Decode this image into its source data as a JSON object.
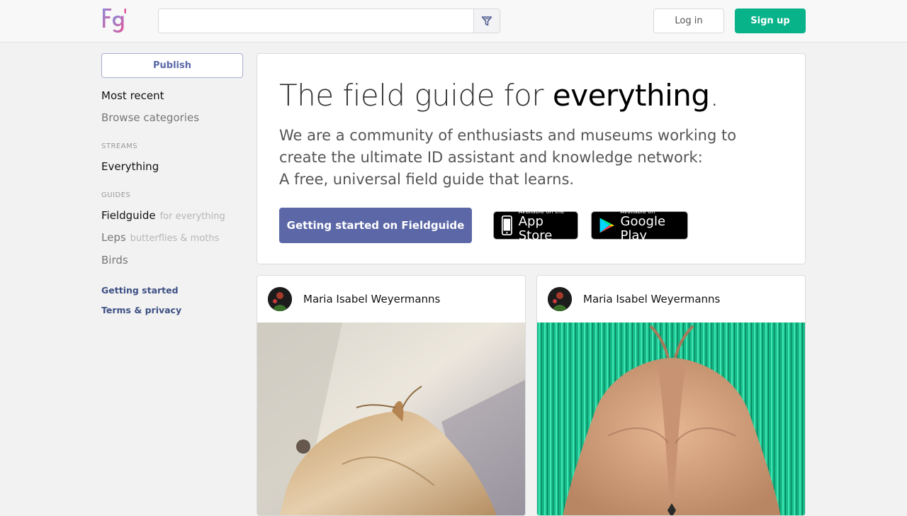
{
  "colors": {
    "accent": "#5b67a6",
    "signup": "#08b38a",
    "link": "#3d5184"
  },
  "header": {
    "logo_text": "Fg",
    "search": {
      "value": "",
      "placeholder": ""
    },
    "filter_icon": "filter-icon",
    "login_label": "Log in",
    "signup_label": "Sign up"
  },
  "sidebar": {
    "publish_label": "Publish",
    "nav": {
      "most_recent": "Most recent",
      "browse": "Browse categories"
    },
    "streams_heading": "STREAMS",
    "streams": [
      {
        "label": "Everything"
      }
    ],
    "guides_heading": "GUIDES",
    "guides": [
      {
        "label": "Fieldguide",
        "sub": "for everything"
      },
      {
        "label": "Leps",
        "sub": "butterflies & moths"
      },
      {
        "label": "Birds",
        "sub": ""
      }
    ],
    "links": {
      "getting_started": "Getting started",
      "terms": "Terms & privacy"
    }
  },
  "hero": {
    "title_light": "The field guide for ",
    "title_strong": "everything",
    "title_end": ".",
    "desc_line1": "We are a community of enthusiasts and museums working to",
    "desc_line2": "create the ultimate ID assistant and knowledge network:",
    "desc_line3": "A free, universal field guide that learns.",
    "cta_label": "Getting started on Fieldguide",
    "app_store": {
      "small": "Available on the",
      "big": "App Store"
    },
    "google_play": {
      "small": "Available on",
      "big": "Google Play"
    }
  },
  "posts": [
    {
      "author": "Maria Isabel Weyermanns"
    },
    {
      "author": "Maria Isabel Weyermanns"
    }
  ]
}
